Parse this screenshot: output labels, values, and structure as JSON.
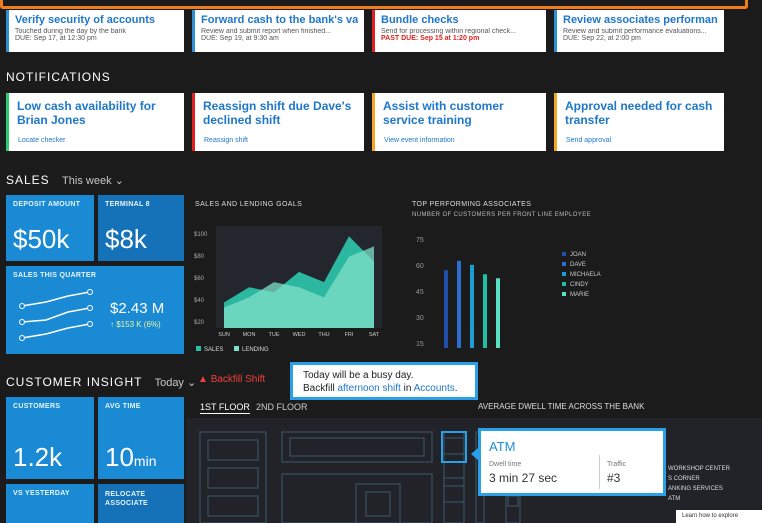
{
  "tasks": [
    {
      "title": "Verify security of accounts",
      "desc": "Touched during the day by the bank",
      "due": "DUE: Sep 17, at 12:30 pm",
      "past_due": false,
      "color": "#2d8fd6"
    },
    {
      "title": "Forward cash to the bank's vaults",
      "desc": "Review and submit report when finished...",
      "due": "DUE: Sep 19, at 9:30 am",
      "past_due": false,
      "color": "#2d8fd6"
    },
    {
      "title": "Bundle checks",
      "desc": "Send for processing within regional check...",
      "due": "PAST DUE: Sep 15 at 1:20 pm",
      "past_due": true,
      "color": "#e02020"
    },
    {
      "title": "Review associates performance",
      "desc": "Review and submit performance evaluations...",
      "due": "DUE: Sep 22, at 2:00 pm",
      "past_due": false,
      "color": "#2d8fd6"
    }
  ],
  "notifications": {
    "title": "NOTIFICATIONS",
    "items": [
      {
        "title": "Low cash availability for Brian Jones",
        "action": "Locate checker",
        "color": "#2ecc71"
      },
      {
        "title": "Reassign shift due Dave's declined shift",
        "action": "Reassign shift",
        "color": "#e02020"
      },
      {
        "title": "Assist with customer service training",
        "action": "View event information",
        "color": "#f5a623"
      },
      {
        "title": "Approval needed for cash transfer",
        "action": "Send approval",
        "color": "#f5a623"
      }
    ]
  },
  "sales": {
    "title": "SALES",
    "period": "This week",
    "deposit": {
      "label": "DEPOSIT AMOUNT",
      "value": "$50k"
    },
    "terminal": {
      "label": "TERMINAL 8",
      "value": "$8k"
    },
    "quarter": {
      "label": "SALES THIS QUARTER",
      "value": "$2.43 M",
      "change": "↑ $153 K (6%)"
    }
  },
  "chart_data": [
    {
      "type": "area",
      "title": "SALES AND LENDING GOALS",
      "categories": [
        "SUN",
        "MON",
        "TUE",
        "WED",
        "THU",
        "FRI",
        "SAT"
      ],
      "yticks": [
        "$100",
        "$80",
        "$60",
        "$40",
        "$20"
      ],
      "ylim": [
        0,
        100
      ],
      "series": [
        {
          "name": "SALES",
          "values": [
            25,
            40,
            35,
            55,
            45,
            90,
            65
          ],
          "color": "#2dbfa6"
        },
        {
          "name": "LENDING",
          "values": [
            20,
            30,
            45,
            40,
            30,
            70,
            80
          ],
          "color": "#7fe0c8"
        }
      ],
      "legend": "bottom"
    },
    {
      "type": "bar",
      "title": "TOP PERFORMING ASSOCIATES",
      "subtitle": "NUMBER OF CUSTOMERS PER FRONT LINE EMPLOYEE",
      "yticks": [
        "75",
        "60",
        "45",
        "30",
        "15"
      ],
      "ylim": [
        0,
        85
      ],
      "series": [
        {
          "name": "JOAN",
          "value": 58,
          "color": "#1f4fa8"
        },
        {
          "name": "DAVE",
          "value": 65,
          "color": "#2d6fd0"
        },
        {
          "name": "MICHAELA",
          "value": 62,
          "color": "#1f9bd6"
        },
        {
          "name": "CINDY",
          "value": 55,
          "color": "#1fbfa6"
        },
        {
          "name": "MARIE",
          "value": 52,
          "color": "#58e0c0"
        }
      ],
      "legend": "right"
    }
  ],
  "insight": {
    "title": "CUSTOMER INSIGHT",
    "period": "Today",
    "alert": "Backfill Shift",
    "tooltip": {
      "line1": "Today will be a busy day.",
      "pre": "Backfill ",
      "link1": "afternoon shift",
      "mid": " in ",
      "link2": "Accounts",
      "post": "."
    },
    "customers": {
      "label": "CUSTOMERS",
      "value": "1.2k"
    },
    "avgtime": {
      "label": "AVG TIME",
      "value": "10",
      "unit": "min"
    },
    "vs": {
      "label": "VS YESTERDAY"
    },
    "relocate": {
      "label": "RELOCATE ASSOCIATE"
    },
    "floors": [
      "1ST FLOOR",
      "2ND FLOOR"
    ],
    "dwell_title": "AVERAGE DWELL TIME ACROSS THE BANK",
    "atm": {
      "title": "ATM",
      "dwell_label": "Dwell time",
      "dwell_value": "3 min 27 sec",
      "traffic_label": "Traffic",
      "traffic_value": "#3"
    },
    "zones": [
      "WORKSHOP CENTER",
      "S CORNER",
      "ANKING SERVICES",
      "ATM"
    ],
    "learn": "Learn how to explore"
  }
}
